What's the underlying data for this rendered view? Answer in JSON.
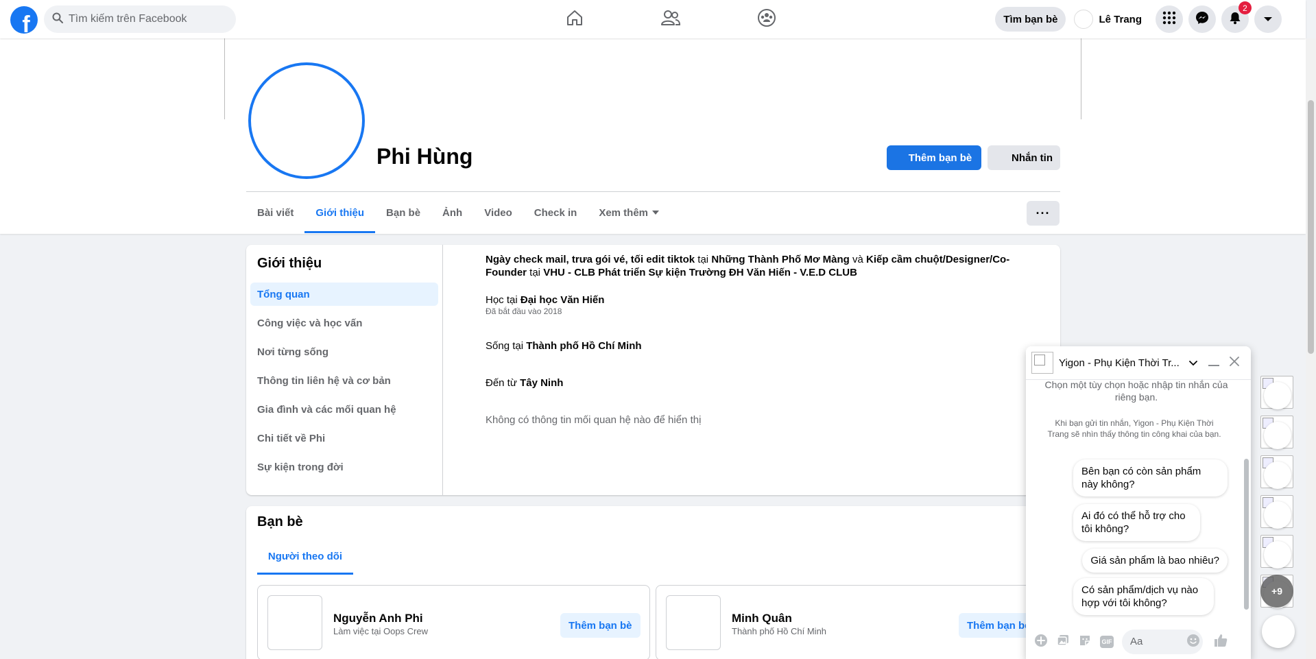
{
  "topbar": {
    "logo": "f",
    "search_placeholder": "Tìm kiếm trên Facebook",
    "nav_icons": [
      "home-icon",
      "friends-icon",
      "groups-icon"
    ],
    "find_friends": "Tìm bạn bè",
    "me_name": "Lê Trang",
    "notif_count": "2",
    "accent": "#1877f2"
  },
  "profile": {
    "name": "Phi Hùng",
    "add_friend": "Thêm bạn bè",
    "message": "Nhắn tin",
    "more": "···",
    "tabs": [
      "Bài viết",
      "Giới thiệu",
      "Bạn bè",
      "Ảnh",
      "Video",
      "Check in",
      "Xem thêm"
    ],
    "active_tab": "Giới thiệu"
  },
  "about": {
    "title": "Giới thiệu",
    "menu": [
      "Tổng quan",
      "Công việc và học vấn",
      "Nơi từng sống",
      "Thông tin liên hệ và cơ bản",
      "Gia đình và các mối quan hệ",
      "Chi tiết về Phi",
      "Sự kiện trong đời"
    ],
    "work": {
      "role1": "Ngày check mail, trưa gói vé, tối edit tiktok",
      "at1": "tại",
      "place1": "Những Thành Phố Mơ Màng",
      "and": "và",
      "role2": "Kiếp cầm chuột/Designer/Co-Founder",
      "at2": "tại",
      "place2": "VHU - CLB Phát triển Sự kiện Trường ĐH Văn Hiến - V.E.D CLUB"
    },
    "study": {
      "prefix": "Học tại",
      "school": "Đại học Văn Hiến",
      "since": "Đã bắt đầu vào 2018"
    },
    "lives": {
      "prefix": "Sống tại",
      "city": "Thành phố Hồ Chí Minh"
    },
    "from": {
      "prefix": "Đến từ",
      "place": "Tây Ninh"
    },
    "relationship": "Không có thông tin mối quan hệ nào để hiển thị"
  },
  "friends": {
    "title": "Bạn bè",
    "tab": "Người theo dõi",
    "items": [
      {
        "name": "Nguyễn Anh Phi",
        "sub": "Làm việc tại Oops Crew",
        "action": "Thêm bạn bè"
      },
      {
        "name": "Minh Quân",
        "sub": "Thành phố Hồ Chí Minh",
        "action": "Thêm bạn bè"
      }
    ]
  },
  "chat": {
    "title": "Yigon - Phụ Kiện Thời Tr...",
    "hint": "Chọn một tùy chọn hoặc nhập tin nhắn của riêng bạn.",
    "note": "Khi bạn gửi tin nhắn, Yigon - Phụ Kiện Thời Trang sẽ nhìn thấy thông tin công khai của bạn.",
    "options": [
      "Bên bạn có còn sản phẩm này không?",
      "Ai đó có thể hỗ trợ cho tôi không?",
      "Giá sản phẩm là bao nhiêu?",
      "Có sản phẩm/dịch vụ nào hợp với tôi không?"
    ],
    "input_placeholder": "Aa",
    "gif_label": "GIF"
  },
  "chat_heads": {
    "more_count": "+9"
  }
}
